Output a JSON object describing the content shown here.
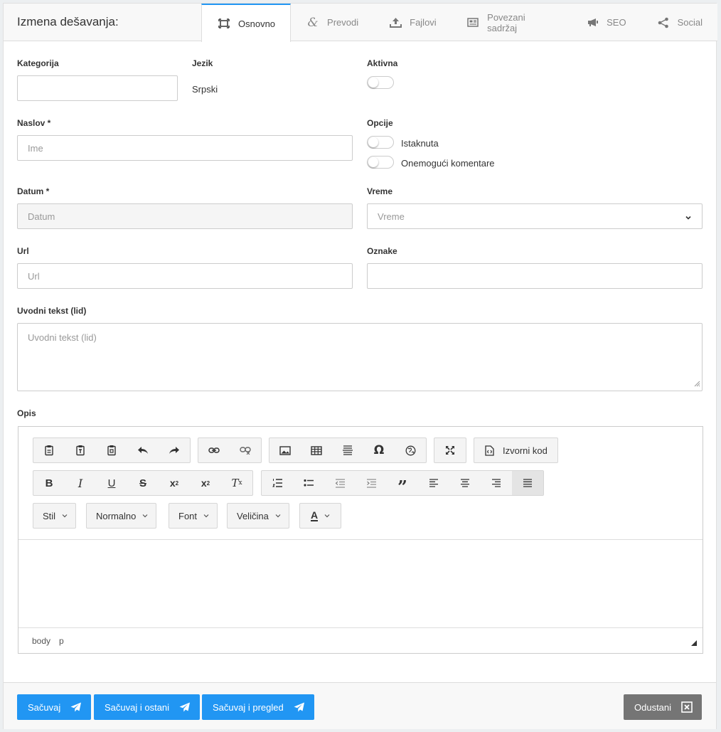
{
  "header": {
    "title": "Izmena dešavanja:"
  },
  "tabs": [
    {
      "label": "Osnovno",
      "icon": "frame-icon"
    },
    {
      "label": "Prevodi",
      "icon": "ampersand-icon"
    },
    {
      "label": "Fajlovi",
      "icon": "upload-icon"
    },
    {
      "label": "Povezani sadržaj",
      "icon": "newspaper-icon"
    },
    {
      "label": "SEO",
      "icon": "megaphone-icon"
    },
    {
      "label": "Social",
      "icon": "share-icon"
    }
  ],
  "form": {
    "kategorija": {
      "label": "Kategorija",
      "value": ""
    },
    "jezik": {
      "label": "Jezik",
      "value": "Srpski"
    },
    "aktivna": {
      "label": "Aktivna",
      "on": false
    },
    "naslov": {
      "label": "Naslov *",
      "placeholder": "Ime"
    },
    "opcije": {
      "label": "Opcije",
      "istaknuta": "Istaknuta",
      "komentari": "Onemogući komentare"
    },
    "datum": {
      "label": "Datum *",
      "placeholder": "Datum"
    },
    "vreme": {
      "label": "Vreme",
      "placeholder": "Vreme"
    },
    "url": {
      "label": "Url",
      "placeholder": "Url"
    },
    "oznake": {
      "label": "Oznake",
      "value": ""
    },
    "lid": {
      "label": "Uvodni tekst (lid)",
      "placeholder": "Uvodni tekst (lid)"
    },
    "opis": {
      "label": "Opis"
    }
  },
  "editor": {
    "source_label": "Izvorni kod",
    "dropdowns": [
      "Stil",
      "Normalno",
      "Font",
      "Veličina"
    ],
    "status": [
      "body",
      "p"
    ]
  },
  "footer": {
    "save": "Sačuvaj",
    "save_stay": "Sačuvaj i ostani",
    "save_preview": "Sačuvaj i pregled",
    "cancel": "Odustani"
  },
  "colors": {
    "accent": "#2196f3",
    "cancel": "#757575"
  }
}
